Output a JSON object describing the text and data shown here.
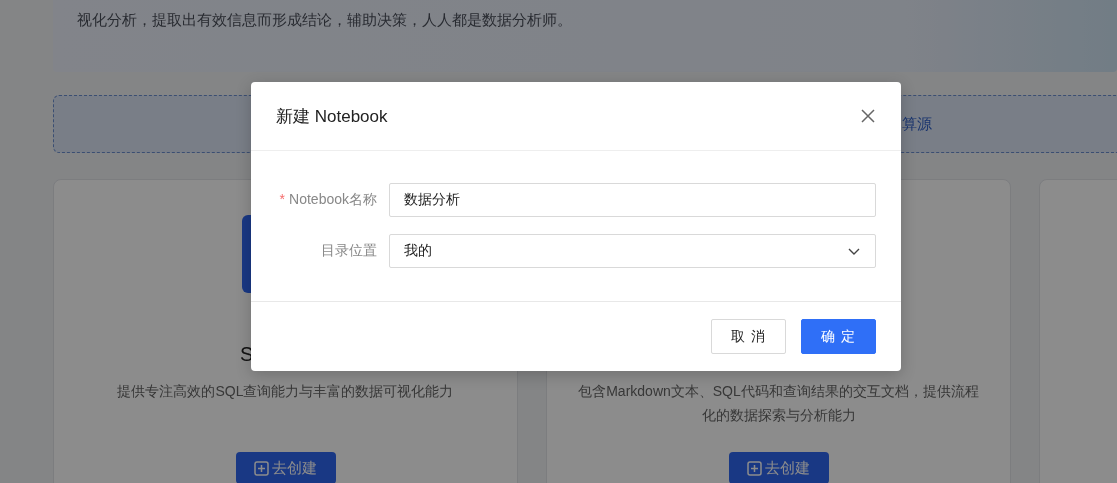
{
  "page": {
    "intro_text": "视化分析，提取出有效信息而形成结论，辅助决策，人人都是数据分析师。",
    "compute_banner": {
      "text": "算源"
    },
    "cards": [
      {
        "icon": true,
        "title": "S",
        "description": "提供专注高效的SQL查询能力与丰富的数据可视化能力",
        "button": "去创建"
      },
      {
        "description": "包含Markdown文本、SQL代码和查询结果的交互文档，提供流程化的数据探索与分析能力",
        "button": "去创建"
      }
    ]
  },
  "dialog": {
    "title": "新建 Notebook",
    "fields": [
      {
        "label": "Notebook名称",
        "required_mark": "*",
        "kind": "text",
        "value": "数据分析"
      },
      {
        "label": "目录位置",
        "kind": "select",
        "value": "我的"
      }
    ],
    "buttons": [
      {
        "label": "取 消",
        "primary": false
      },
      {
        "label": "确 定",
        "primary": true
      }
    ]
  }
}
